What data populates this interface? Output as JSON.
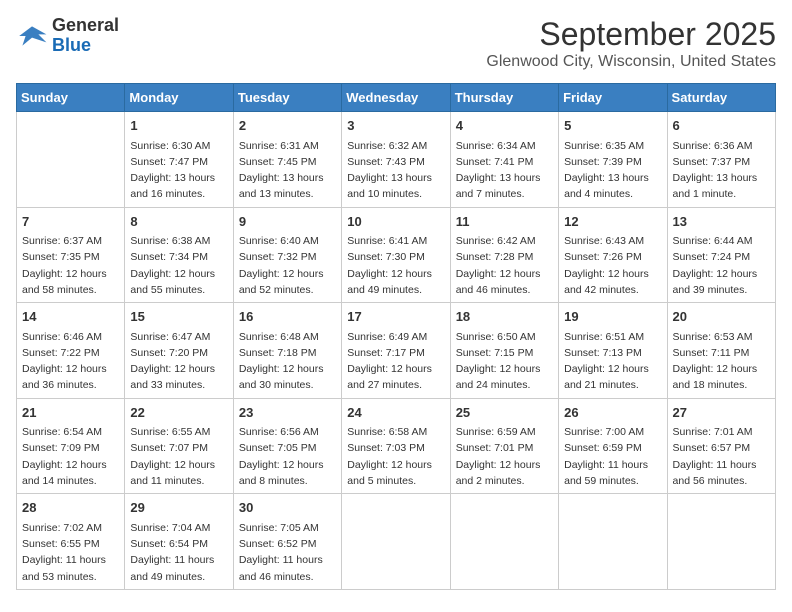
{
  "logo": {
    "line1": "General",
    "line2": "Blue"
  },
  "title": "September 2025",
  "subtitle": "Glenwood City, Wisconsin, United States",
  "weekdays": [
    "Sunday",
    "Monday",
    "Tuesday",
    "Wednesday",
    "Thursday",
    "Friday",
    "Saturday"
  ],
  "weeks": [
    [
      {
        "day": "",
        "info": ""
      },
      {
        "day": "1",
        "info": "Sunrise: 6:30 AM\nSunset: 7:47 PM\nDaylight: 13 hours\nand 16 minutes."
      },
      {
        "day": "2",
        "info": "Sunrise: 6:31 AM\nSunset: 7:45 PM\nDaylight: 13 hours\nand 13 minutes."
      },
      {
        "day": "3",
        "info": "Sunrise: 6:32 AM\nSunset: 7:43 PM\nDaylight: 13 hours\nand 10 minutes."
      },
      {
        "day": "4",
        "info": "Sunrise: 6:34 AM\nSunset: 7:41 PM\nDaylight: 13 hours\nand 7 minutes."
      },
      {
        "day": "5",
        "info": "Sunrise: 6:35 AM\nSunset: 7:39 PM\nDaylight: 13 hours\nand 4 minutes."
      },
      {
        "day": "6",
        "info": "Sunrise: 6:36 AM\nSunset: 7:37 PM\nDaylight: 13 hours\nand 1 minute."
      }
    ],
    [
      {
        "day": "7",
        "info": "Sunrise: 6:37 AM\nSunset: 7:35 PM\nDaylight: 12 hours\nand 58 minutes."
      },
      {
        "day": "8",
        "info": "Sunrise: 6:38 AM\nSunset: 7:34 PM\nDaylight: 12 hours\nand 55 minutes."
      },
      {
        "day": "9",
        "info": "Sunrise: 6:40 AM\nSunset: 7:32 PM\nDaylight: 12 hours\nand 52 minutes."
      },
      {
        "day": "10",
        "info": "Sunrise: 6:41 AM\nSunset: 7:30 PM\nDaylight: 12 hours\nand 49 minutes."
      },
      {
        "day": "11",
        "info": "Sunrise: 6:42 AM\nSunset: 7:28 PM\nDaylight: 12 hours\nand 46 minutes."
      },
      {
        "day": "12",
        "info": "Sunrise: 6:43 AM\nSunset: 7:26 PM\nDaylight: 12 hours\nand 42 minutes."
      },
      {
        "day": "13",
        "info": "Sunrise: 6:44 AM\nSunset: 7:24 PM\nDaylight: 12 hours\nand 39 minutes."
      }
    ],
    [
      {
        "day": "14",
        "info": "Sunrise: 6:46 AM\nSunset: 7:22 PM\nDaylight: 12 hours\nand 36 minutes."
      },
      {
        "day": "15",
        "info": "Sunrise: 6:47 AM\nSunset: 7:20 PM\nDaylight: 12 hours\nand 33 minutes."
      },
      {
        "day": "16",
        "info": "Sunrise: 6:48 AM\nSunset: 7:18 PM\nDaylight: 12 hours\nand 30 minutes."
      },
      {
        "day": "17",
        "info": "Sunrise: 6:49 AM\nSunset: 7:17 PM\nDaylight: 12 hours\nand 27 minutes."
      },
      {
        "day": "18",
        "info": "Sunrise: 6:50 AM\nSunset: 7:15 PM\nDaylight: 12 hours\nand 24 minutes."
      },
      {
        "day": "19",
        "info": "Sunrise: 6:51 AM\nSunset: 7:13 PM\nDaylight: 12 hours\nand 21 minutes."
      },
      {
        "day": "20",
        "info": "Sunrise: 6:53 AM\nSunset: 7:11 PM\nDaylight: 12 hours\nand 18 minutes."
      }
    ],
    [
      {
        "day": "21",
        "info": "Sunrise: 6:54 AM\nSunset: 7:09 PM\nDaylight: 12 hours\nand 14 minutes."
      },
      {
        "day": "22",
        "info": "Sunrise: 6:55 AM\nSunset: 7:07 PM\nDaylight: 12 hours\nand 11 minutes."
      },
      {
        "day": "23",
        "info": "Sunrise: 6:56 AM\nSunset: 7:05 PM\nDaylight: 12 hours\nand 8 minutes."
      },
      {
        "day": "24",
        "info": "Sunrise: 6:58 AM\nSunset: 7:03 PM\nDaylight: 12 hours\nand 5 minutes."
      },
      {
        "day": "25",
        "info": "Sunrise: 6:59 AM\nSunset: 7:01 PM\nDaylight: 12 hours\nand 2 minutes."
      },
      {
        "day": "26",
        "info": "Sunrise: 7:00 AM\nSunset: 6:59 PM\nDaylight: 11 hours\nand 59 minutes."
      },
      {
        "day": "27",
        "info": "Sunrise: 7:01 AM\nSunset: 6:57 PM\nDaylight: 11 hours\nand 56 minutes."
      }
    ],
    [
      {
        "day": "28",
        "info": "Sunrise: 7:02 AM\nSunset: 6:55 PM\nDaylight: 11 hours\nand 53 minutes."
      },
      {
        "day": "29",
        "info": "Sunrise: 7:04 AM\nSunset: 6:54 PM\nDaylight: 11 hours\nand 49 minutes."
      },
      {
        "day": "30",
        "info": "Sunrise: 7:05 AM\nSunset: 6:52 PM\nDaylight: 11 hours\nand 46 minutes."
      },
      {
        "day": "",
        "info": ""
      },
      {
        "day": "",
        "info": ""
      },
      {
        "day": "",
        "info": ""
      },
      {
        "day": "",
        "info": ""
      }
    ]
  ]
}
